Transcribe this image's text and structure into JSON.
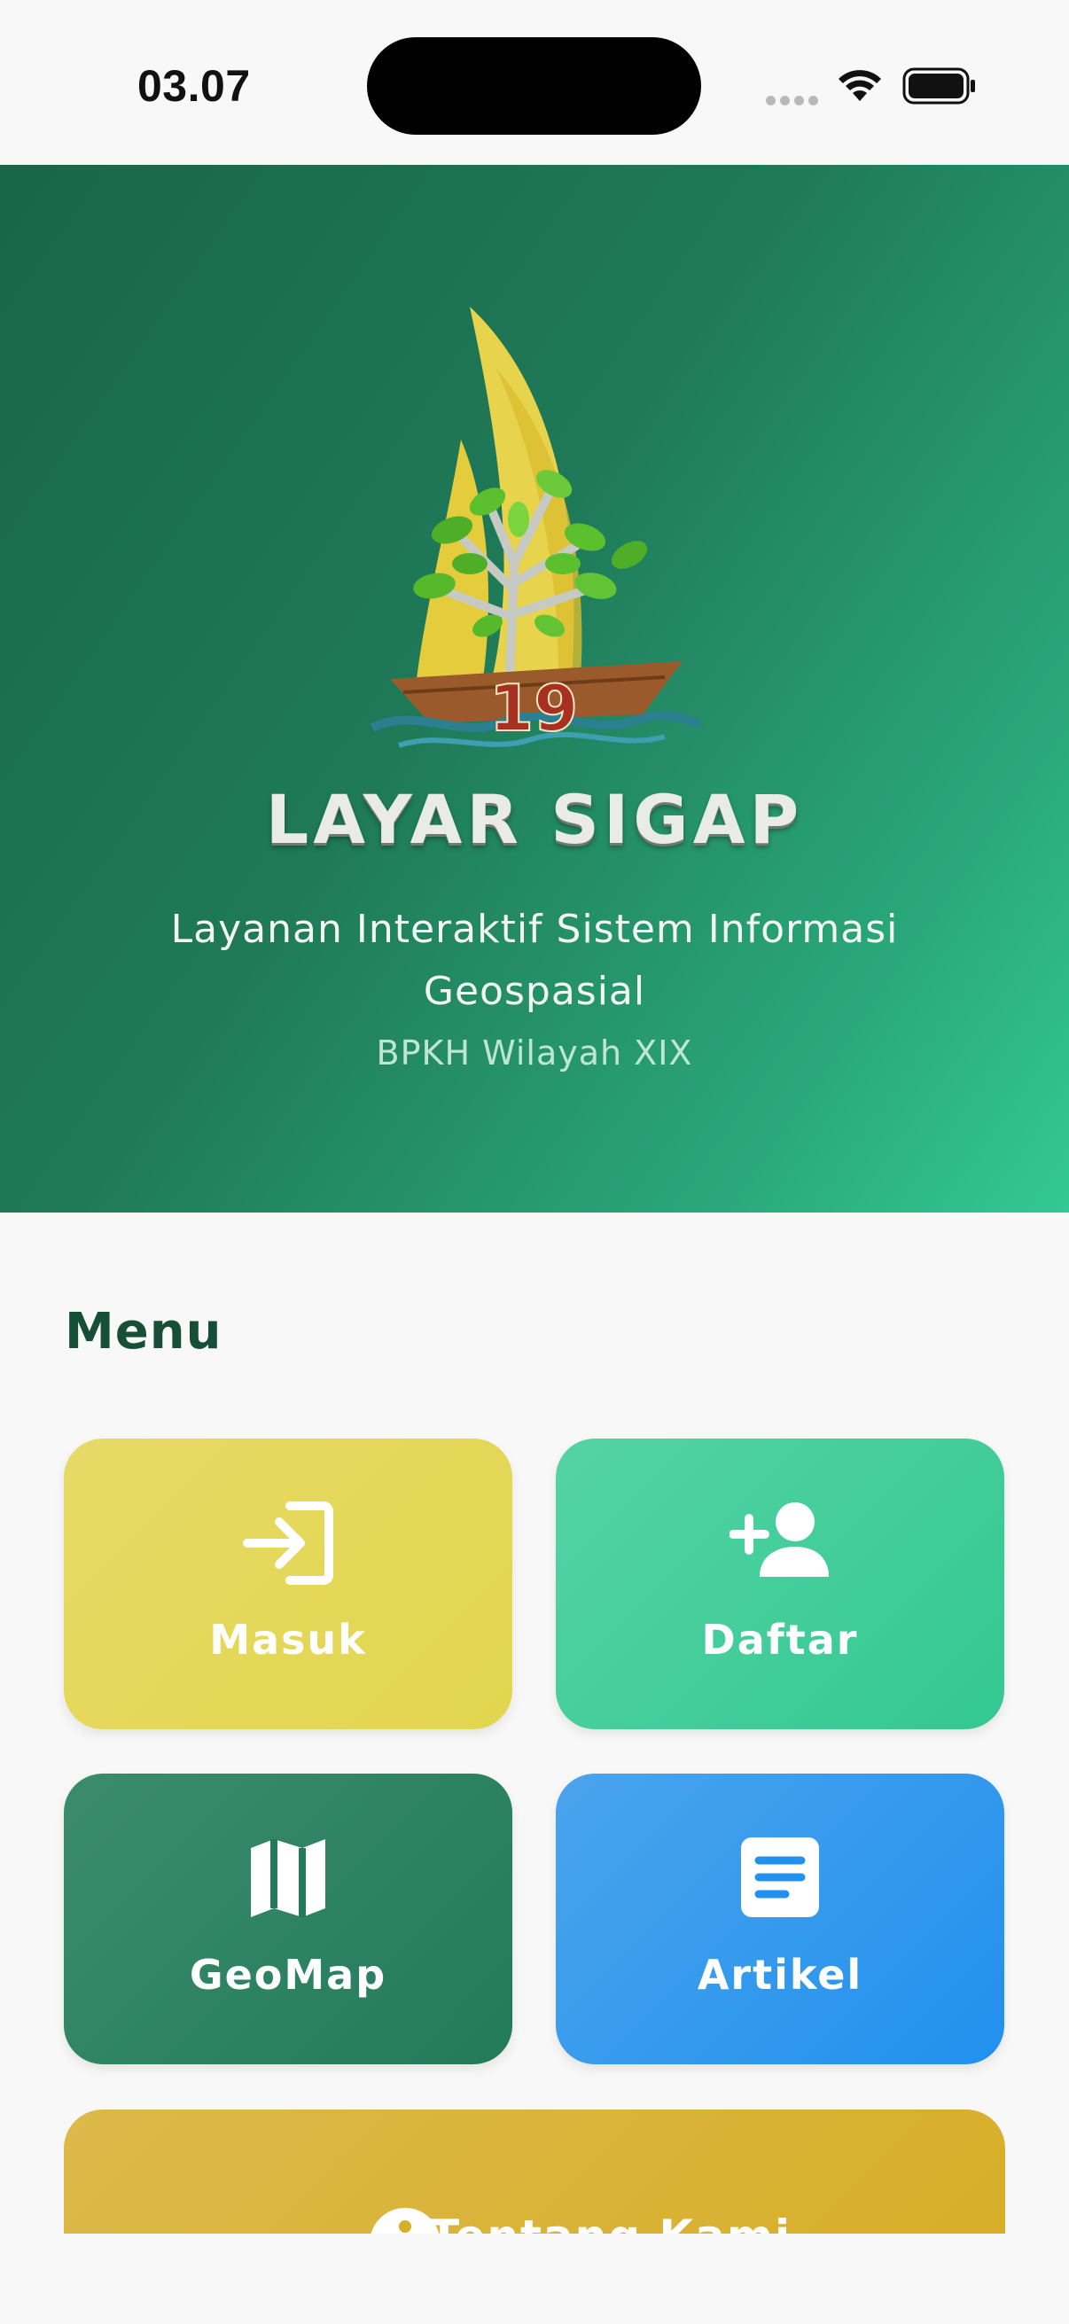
{
  "status_bar": {
    "time": "03.07",
    "wifi_icon": "wifi-icon",
    "battery_icon": "battery-icon"
  },
  "hero": {
    "logo_icon": "layar-sigap-sailboat-tree-logo",
    "brand_title": "LAYAR SIGAP",
    "tagline": "Layanan Interaktif Sistem Informasi Geospasial",
    "org": "BPKH Wilayah XIX",
    "colors": {
      "gradient_start": "#186648",
      "gradient_end": "#33c992"
    }
  },
  "menu": {
    "title": "Menu",
    "items": [
      {
        "label": "Masuk",
        "icon": "login-icon",
        "color": "#e3d64e"
      },
      {
        "label": "Daftar",
        "icon": "person-add-icon",
        "color": "#33c892"
      },
      {
        "label": "GeoMap",
        "icon": "map-icon",
        "color": "#237a5b"
      },
      {
        "label": "Artikel",
        "icon": "article-icon",
        "color": "#2190ee"
      }
    ],
    "about": {
      "label": "Tentang Kami",
      "icon": "info-icon",
      "color": "#d7ae27"
    }
  }
}
